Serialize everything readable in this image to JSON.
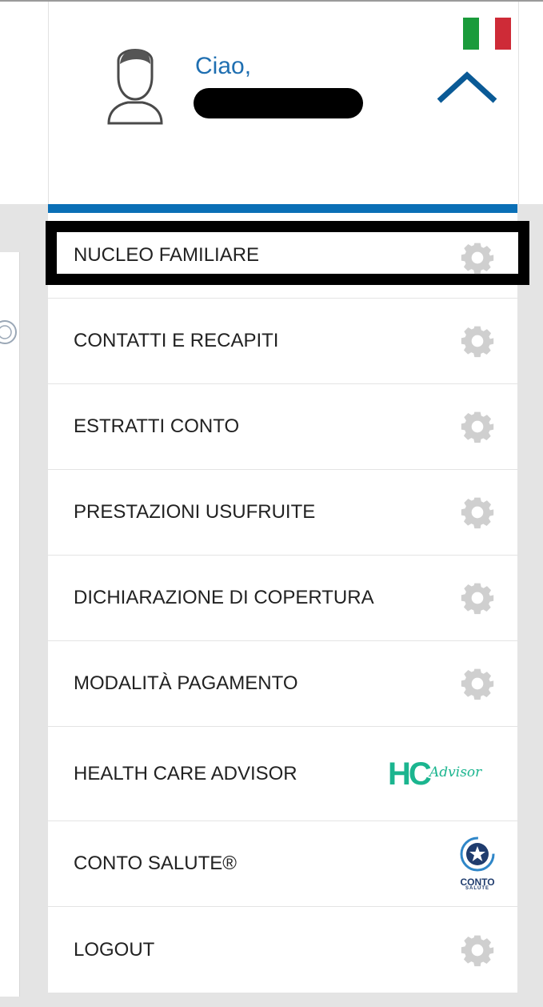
{
  "header": {
    "greeting": "Ciao,",
    "flag_colors": [
      "#1a9b3b",
      "#ffffff",
      "#ce2b37"
    ]
  },
  "menu": [
    {
      "label": "NUCLEO FAMILIARE",
      "icon": "gear-icon"
    },
    {
      "label": "CONTATTI E RECAPITI",
      "icon": "gear-icon"
    },
    {
      "label": "ESTRATTI CONTO",
      "icon": "gear-icon"
    },
    {
      "label": "PRESTAZIONI USUFRUITE",
      "icon": "gear-icon"
    },
    {
      "label": "DICHIARAZIONE DI COPERTURA",
      "icon": "gear-icon"
    },
    {
      "label": "MODALITÀ PAGAMENTO",
      "icon": "gear-icon"
    },
    {
      "label": "HEALTH CARE ADVISOR",
      "icon": "hc-advisor-logo"
    },
    {
      "label": "CONTO SALUTE®",
      "icon": "conto-salute-logo"
    },
    {
      "label": "LOGOUT",
      "icon": "gear-icon"
    }
  ],
  "logos": {
    "hc_advisor": {
      "mark": "HC",
      "script": "Advisor"
    },
    "conto_salute": {
      "line1": "CONTO",
      "line2": "SALUTE"
    }
  },
  "colors": {
    "accent_blue": "#0a6fb6",
    "greeting_blue": "#1f6fb1",
    "gear_gray": "#cfcfcf",
    "hc_green": "#1bb58f"
  }
}
